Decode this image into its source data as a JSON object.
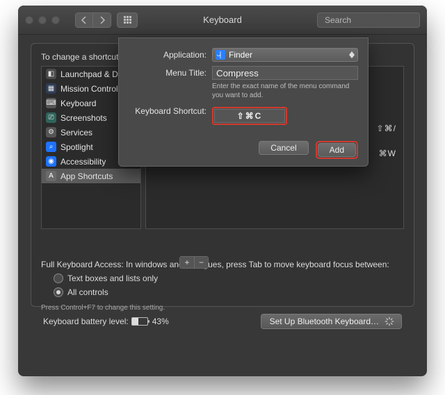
{
  "window": {
    "title": "Keyboard",
    "search_placeholder": "Search"
  },
  "intro_text": "To change a shortcut, select it, double-click the key combination, then type the new keys.",
  "sidebar": {
    "items": [
      {
        "label": "Launchpad & Dock",
        "icon": "launchpad"
      },
      {
        "label": "Mission Control",
        "icon": "mission"
      },
      {
        "label": "Keyboard",
        "icon": "keyboard"
      },
      {
        "label": "Screenshots",
        "icon": "screenshot"
      },
      {
        "label": "Services",
        "icon": "services"
      },
      {
        "label": "Spotlight",
        "icon": "spotlight"
      },
      {
        "label": "Accessibility",
        "icon": "accessibility"
      },
      {
        "label": "App Shortcuts",
        "icon": "appsc"
      }
    ],
    "selected_index": 7
  },
  "shortcuts_visible": [
    {
      "keys": "⇧⌘/"
    },
    {
      "keys": "⌘W"
    }
  ],
  "addremove": {
    "plus": "+",
    "minus": "−"
  },
  "fka_text": "Full Keyboard Access: In windows and dialogues, press Tab to move keyboard focus between:",
  "radios": [
    {
      "label": "Text boxes and lists only",
      "on": false
    },
    {
      "label": "All controls",
      "on": true
    }
  ],
  "hint_text": "Press Control+F7 to change this setting.",
  "footer": {
    "battery_label": "Keyboard battery level:",
    "battery_pct_text": "43%",
    "battery_pct": 43,
    "bluetooth_btn": "Set Up Bluetooth Keyboard…"
  },
  "dialog": {
    "app_label": "Application:",
    "app_value": "Finder",
    "menu_label": "Menu Title:",
    "menu_value": "Compress",
    "menu_hint": "Enter the exact name of the menu command you want to add.",
    "shortcut_label": "Keyboard Shortcut:",
    "shortcut_value": "⇧⌘C",
    "cancel": "Cancel",
    "add": "Add"
  }
}
